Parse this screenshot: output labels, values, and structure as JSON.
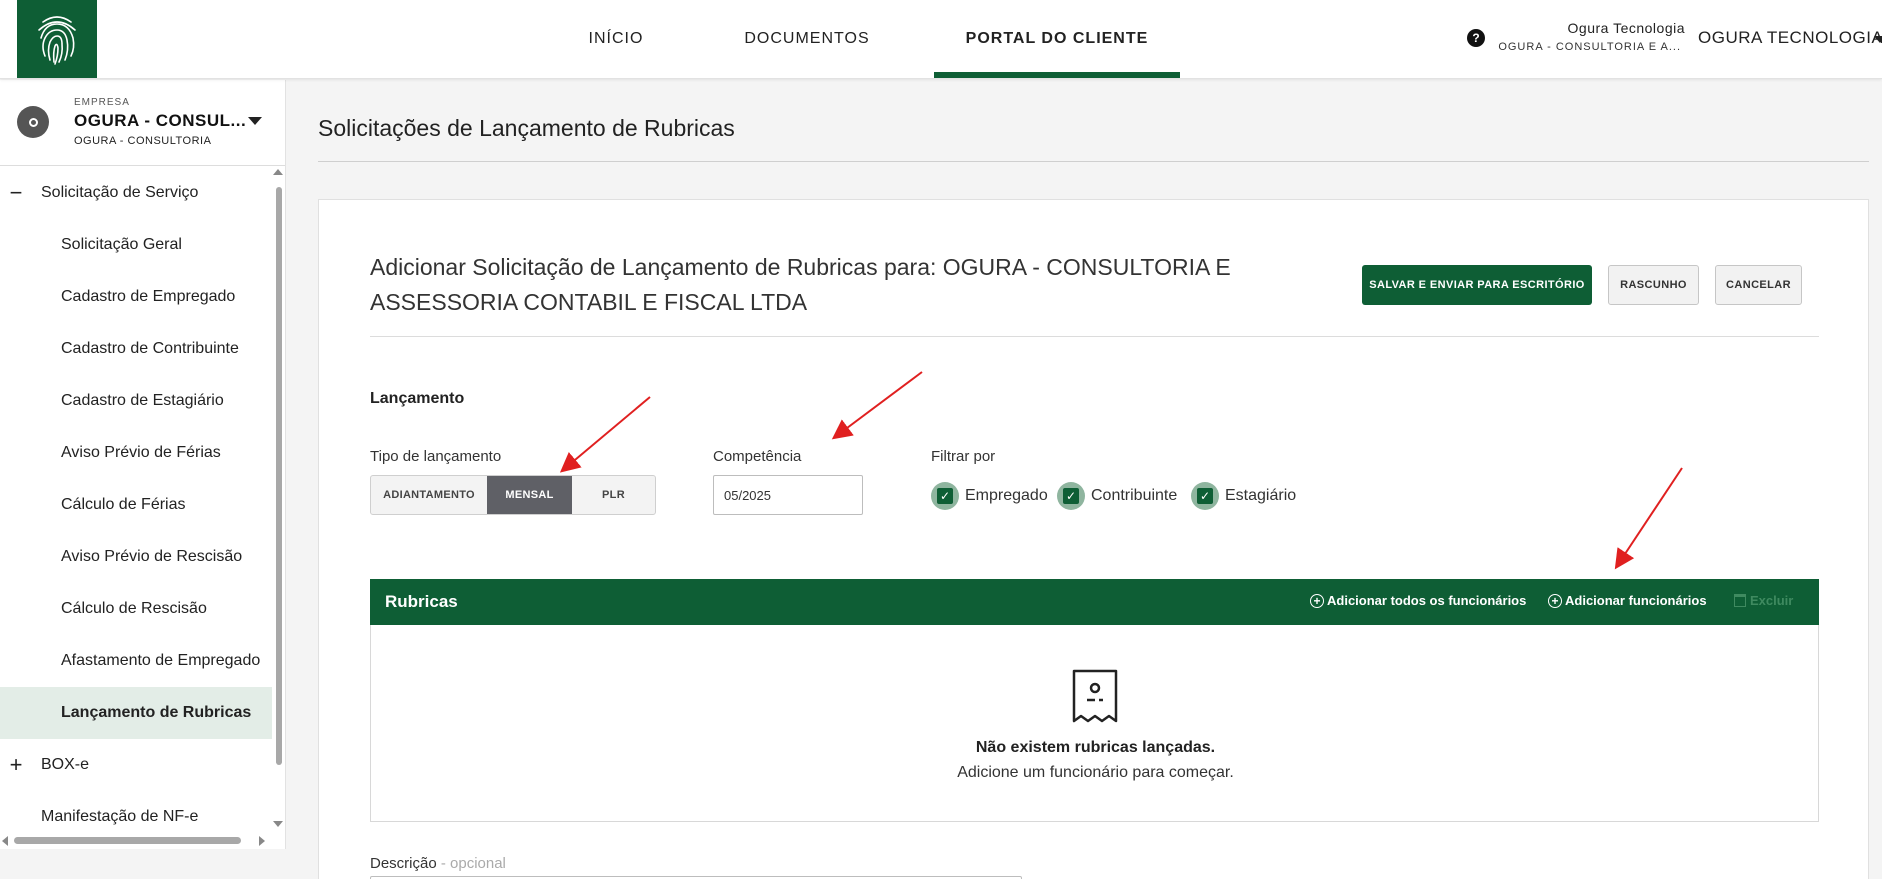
{
  "header": {
    "nav": [
      {
        "label": "INÍCIO",
        "active": false
      },
      {
        "label": "DOCUMENTOS",
        "active": false
      },
      {
        "label": "PORTAL DO CLIENTE",
        "active": true
      }
    ],
    "help_icon": "question-icon",
    "user_name": "Ogura Tecnologia",
    "user_company": "OGURA - CONSULTORIA E A...",
    "user_menu_label": "OGURA TECNOLOGIA",
    "accent_color": "#0e5e35"
  },
  "sidebar": {
    "company": {
      "label": "EMPRESA",
      "name": "OGURA - CONSUL...",
      "sub": "OGURA - CONSULTORIA"
    },
    "items": [
      {
        "label": "Solicitação de Serviço",
        "type": "group",
        "sign": "−"
      },
      {
        "label": "Solicitação Geral",
        "type": "sub"
      },
      {
        "label": "Cadastro de Empregado",
        "type": "sub"
      },
      {
        "label": "Cadastro de Contribuinte",
        "type": "sub"
      },
      {
        "label": "Cadastro de Estagiário",
        "type": "sub"
      },
      {
        "label": "Aviso Prévio de Férias",
        "type": "sub"
      },
      {
        "label": "Cálculo de Férias",
        "type": "sub"
      },
      {
        "label": "Aviso Prévio de Rescisão",
        "type": "sub"
      },
      {
        "label": "Cálculo de Rescisão",
        "type": "sub"
      },
      {
        "label": "Afastamento de Empregado",
        "type": "sub"
      },
      {
        "label": "Lançamento de Rubricas",
        "type": "sub",
        "active": true
      },
      {
        "label": "BOX-e",
        "type": "group",
        "sign": "+"
      },
      {
        "label": "Manifestação de NF-e",
        "type": "group"
      }
    ]
  },
  "main": {
    "page_title": "Solicitações de Lançamento de Rubricas",
    "card_title_line1": "Adicionar Solicitação de Lançamento de Rubricas para: OGURA - CONSULTORIA E",
    "card_title_line2": "ASSESSORIA CONTABIL E FISCAL LTDA",
    "buttons": {
      "save": "SALVAR E ENVIAR PARA ESCRITÓRIO",
      "draft": "RASCUNHO",
      "cancel": "CANCELAR"
    },
    "section_label": "Lançamento",
    "tipo": {
      "label": "Tipo de lançamento",
      "options": [
        "ADIANTAMENTO",
        "MENSAL",
        "PLR"
      ],
      "selected": "MENSAL"
    },
    "competencia": {
      "label": "Competência",
      "value": "05/2025"
    },
    "filtro": {
      "label": "Filtrar por",
      "options": [
        {
          "label": "Empregado",
          "checked": true
        },
        {
          "label": "Contribuinte",
          "checked": true
        },
        {
          "label": "Estagiário",
          "checked": true
        }
      ]
    },
    "rubricas": {
      "title": "Rubricas",
      "add_all": "Adicionar todos os funcionários",
      "add": "Adicionar funcionários",
      "delete": "Excluir",
      "empty_title": "Não existem rubricas lançadas.",
      "empty_sub": "Adicione um funcionário para começar."
    },
    "descricao": {
      "label": "Descrição",
      "optional": " - opcional"
    }
  },
  "annotation_color": "#e02020"
}
